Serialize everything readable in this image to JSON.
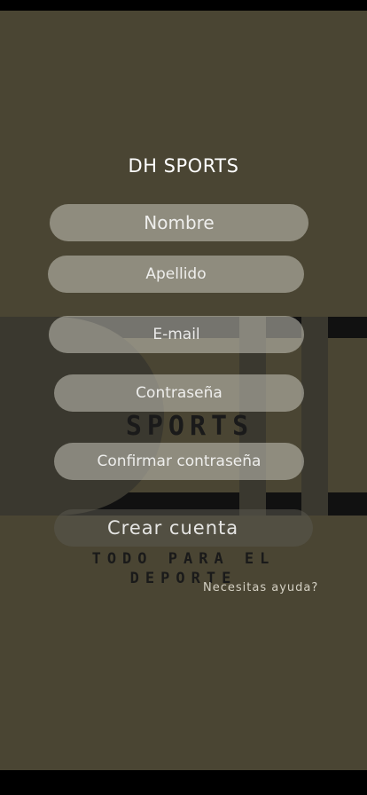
{
  "app": {
    "title": "DH SPORTS"
  },
  "background_logo": {
    "monogram": "DH",
    "word": "SPORTS",
    "tagline_line1": "TODO PARA EL",
    "tagline_line2": "DEPORTE"
  },
  "form": {
    "nombre_placeholder": "Nombre",
    "apellido_placeholder": "Apellido",
    "email_placeholder": "E-mail",
    "password_placeholder": "Contraseña",
    "confirm_placeholder": "Confirmar contraseña",
    "submit_label": "Crear cuenta"
  },
  "help_link": "Necesitas ayuda?",
  "colors": {
    "background": "#4a4533",
    "field": "#c8c6bc",
    "text": "#ffffff"
  }
}
